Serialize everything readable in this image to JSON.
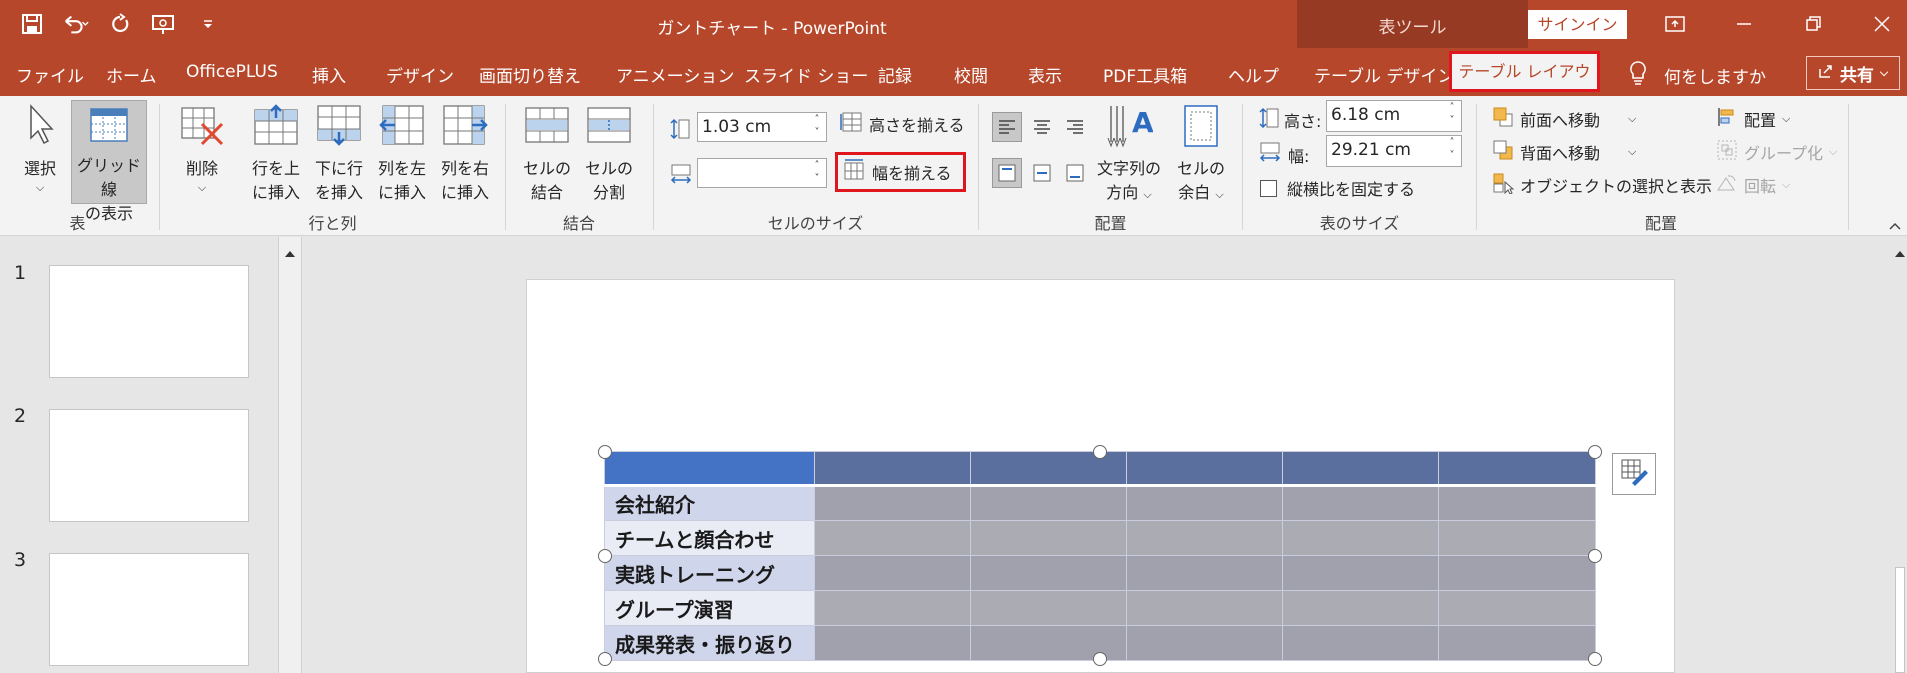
{
  "app": {
    "title": "ガントチャート  -  PowerPoint",
    "tool_context": "表ツール",
    "signin": "サインイン"
  },
  "tabs": [
    "ファイル",
    "ホーム",
    "OfficePLUS",
    "挿入",
    "デザイン",
    "画面切り替え",
    "アニメーション",
    "スライド ショー",
    "記録",
    "校閲",
    "表示",
    "PDF工具箱",
    "ヘルプ",
    "テーブル デザイン"
  ],
  "active_tab": "テーブル レイアウト",
  "search_placeholder": "何をしますか",
  "share_label": "共有",
  "ribbon": {
    "groups": {
      "table": "表",
      "rows_cols": "行と列",
      "merge": "結合",
      "cell_size": "セルのサイズ",
      "alignment": "配置",
      "table_size": "表のサイズ",
      "arrange": "配置"
    },
    "select_label": "選択",
    "gridlines_1": "グリッド線",
    "gridlines_2": "の表示",
    "delete_label": "削除",
    "insert_above_1": "行を上",
    "insert_above_2": "に挿入",
    "insert_below_1": "下に行",
    "insert_below_2": "を挿入",
    "insert_left_1": "列を左",
    "insert_left_2": "に挿入",
    "insert_right_1": "列を右",
    "insert_right_2": "に挿入",
    "merge_cells_1": "セルの",
    "merge_cells_2": "結合",
    "split_cells_1": "セルの",
    "split_cells_2": "分割",
    "cell_height_value": "1.03 cm",
    "cell_width_value": "",
    "distribute_rows": "高さを揃える",
    "distribute_cols": "幅を揃える",
    "text_direction_1": "文字列の",
    "text_direction_2": "方向",
    "cell_margins_1": "セルの",
    "cell_margins_2": "余白",
    "height_label": "高さ:",
    "height_value": "6.18 cm",
    "width_label": "幅:",
    "width_value": "29.21 cm",
    "lock_aspect": "縦横比を固定する",
    "bring_forward": "前面へ移動",
    "send_backward": "背面へ移動",
    "selection_pane": "オブジェクトの選択と表示",
    "align": "配置",
    "group": "グループ化",
    "rotate": "回転"
  },
  "thumbnails": [
    "1",
    "2",
    "3"
  ],
  "table": {
    "rows": [
      "会社紹介",
      "チームと顔合わせ",
      "実践トレーニング",
      "グループ演習",
      "成果発表・振り返り"
    ]
  },
  "colors": {
    "accent": "#b7472a",
    "header_blue": "#4472c4",
    "highlight_red": "#e0161e"
  }
}
